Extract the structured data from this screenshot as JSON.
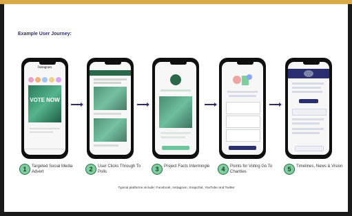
{
  "slide": {
    "title": "Example User Journey:",
    "footer": "Typical platforms include: Facebook, Instagram, Snapchat, YouTube and Twitter"
  },
  "steps": [
    {
      "number": "1",
      "label": "Targeted Social Media Advert"
    },
    {
      "number": "2",
      "label": "User Clicks Through To Polls"
    },
    {
      "number": "3",
      "label": "Project Facts Intermingle"
    },
    {
      "number": "4",
      "label": "Points for Voting Go To Charities"
    },
    {
      "number": "5",
      "label": "Timelines, News & Vision"
    }
  ],
  "phones": {
    "p1": {
      "app_name": "Instagram",
      "overlay_text": "VOTE NOW"
    }
  }
}
